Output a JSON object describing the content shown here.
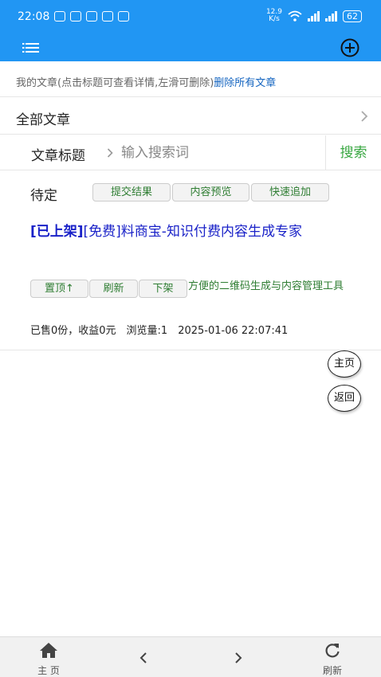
{
  "status_bar": {
    "time": "22:08",
    "net_speed_value": "12.9",
    "net_speed_unit": "K/s",
    "battery": "62"
  },
  "header": {
    "info_text": "我的文章(点击标题可查看详情,左滑可删除)",
    "delete_all_link": "删除所有文章",
    "all_articles_label": "全部文章"
  },
  "search": {
    "field_label": "文章标题",
    "placeholder": "输入搜索词",
    "button_label": "搜索"
  },
  "article": {
    "status": "待定",
    "chips": [
      "提交结果",
      "内容预览",
      "快速追加"
    ],
    "tag_listed": "[已上架]",
    "title_text": "[免费]料商宝-知识付费内容生成专家",
    "actions": [
      "置顶↑",
      "刷新",
      "下架"
    ],
    "description": "方便的二维码生成与内容管理工具",
    "stats": "已售0份，收益0元　浏览量:1　2025-01-06 22:07:41"
  },
  "floating": {
    "home_label": "主页",
    "back_label": "返回"
  },
  "bottom_nav": {
    "home_label": "主 页",
    "refresh_label": "刷新"
  },
  "colors": {
    "app_bar": "#2196f3",
    "link": "#1565c0",
    "title": "#1a22c8",
    "action_green": "#2e7d32",
    "search_green": "#3aa843"
  }
}
